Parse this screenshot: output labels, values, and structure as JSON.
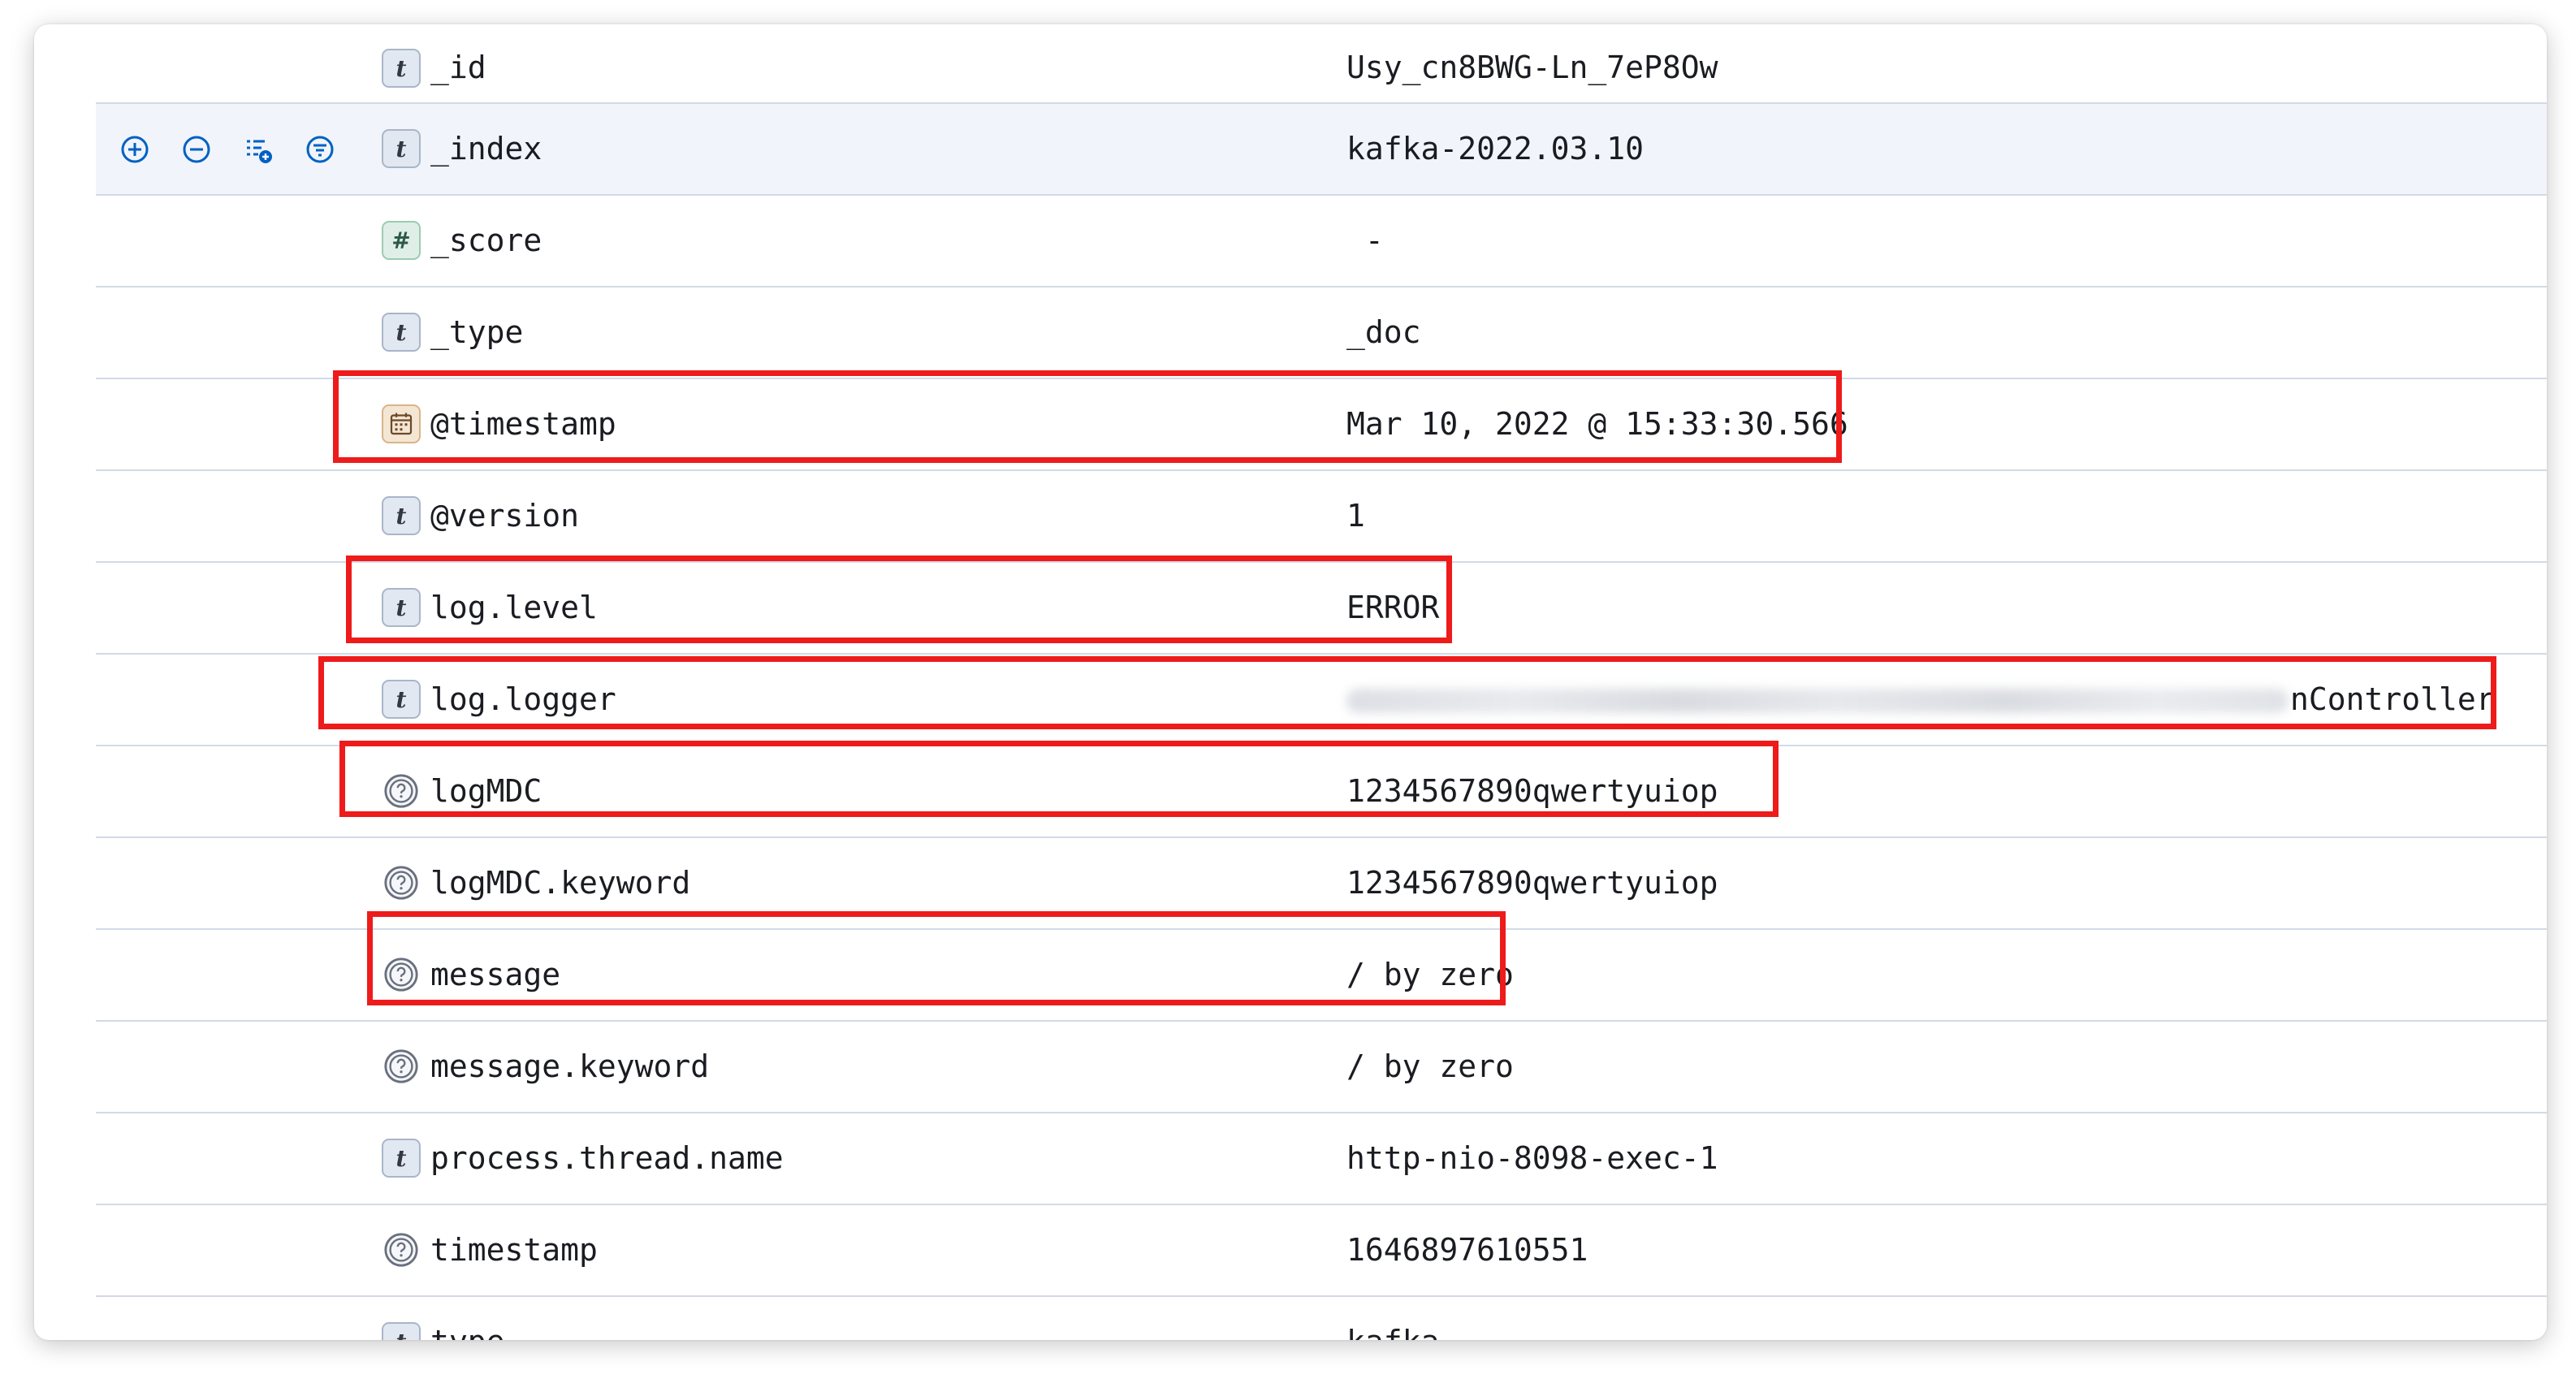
{
  "toolbar": {
    "icons": [
      "zoom-in-icon",
      "zoom-out-icon",
      "toggle-column-icon",
      "filter-exists-icon"
    ]
  },
  "fields": [
    {
      "type_icon": "text-type-icon",
      "name": "_id",
      "value": "Usy_cn8BWG-Ln_7eP8Ow"
    },
    {
      "type_icon": "text-type-icon",
      "name": "_index",
      "value": "kafka-2022.03.10",
      "hovered": true
    },
    {
      "type_icon": "number-type-icon",
      "name": "_score",
      "value": " -"
    },
    {
      "type_icon": "text-type-icon",
      "name": "_type",
      "value": "_doc"
    },
    {
      "type_icon": "date-type-icon",
      "name": "@timestamp",
      "value": "Mar 10, 2022 @ 15:33:30.566",
      "highlighted": true
    },
    {
      "type_icon": "text-type-icon",
      "name": "@version",
      "value": "1"
    },
    {
      "type_icon": "text-type-icon",
      "name": "log.level",
      "value": "ERROR",
      "highlighted": true
    },
    {
      "type_icon": "text-type-icon",
      "name": "log.logger",
      "value": "nController",
      "value_obscured": true,
      "highlighted": true
    },
    {
      "type_icon": "unknown-type-icon",
      "name": "logMDC",
      "value": "1234567890qwertyuiop",
      "highlighted": true
    },
    {
      "type_icon": "unknown-type-icon",
      "name": "logMDC.keyword",
      "value": "1234567890qwertyuiop"
    },
    {
      "type_icon": "unknown-type-icon",
      "name": "message",
      "value": "/ by zero",
      "highlighted": true
    },
    {
      "type_icon": "unknown-type-icon",
      "name": "message.keyword",
      "value": "/ by zero"
    },
    {
      "type_icon": "text-type-icon",
      "name": "process.thread.name",
      "value": "http-nio-8098-exec-1"
    },
    {
      "type_icon": "unknown-type-icon",
      "name": "timestamp",
      "value": "1646897610551"
    },
    {
      "type_icon": "text-type-icon",
      "name": "type",
      "value": "kafka"
    }
  ],
  "type_glyphs": {
    "text": "t",
    "number": "#"
  },
  "colors": {
    "highlight_box": "#ee1b1b",
    "row_border": "#d3dae6",
    "hover_row": "#f1f4fa",
    "action_icon": "#0061c2"
  }
}
